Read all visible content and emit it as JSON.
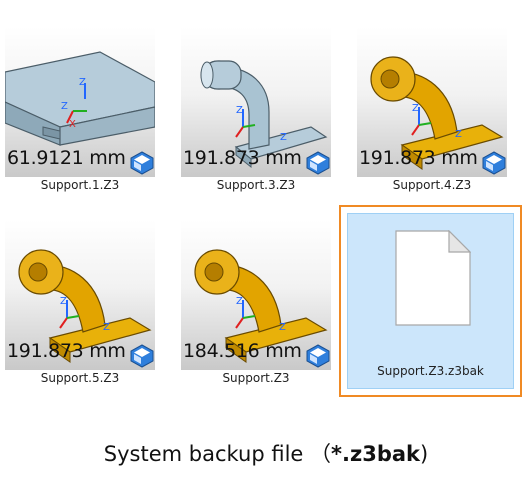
{
  "files": [
    {
      "name": "Support.1.Z3",
      "measurement": "61.9121 mm",
      "model": "plate",
      "color": "#a9c3d2"
    },
    {
      "name": "Support.3.Z3",
      "measurement": "191.873 mm",
      "model": "bracket",
      "color": "#a9c3d2"
    },
    {
      "name": "Support.4.Z3",
      "measurement": "191.873 mm",
      "model": "bracket",
      "color": "#e2a400"
    },
    {
      "name": "Support.5.Z3",
      "measurement": "191.873 mm",
      "model": "bracket",
      "color": "#e2a400"
    },
    {
      "name": "Support.Z3",
      "measurement": "184.516 mm",
      "model": "bracket",
      "color": "#e2a400"
    }
  ],
  "backup_file": {
    "name": "Support.Z3.z3bak",
    "selected": true,
    "highlight_color": "#f08a24"
  },
  "caption": {
    "text": "System backup file",
    "paren_open": "（",
    "extension": "*.z3bak",
    "paren_close": ")"
  }
}
